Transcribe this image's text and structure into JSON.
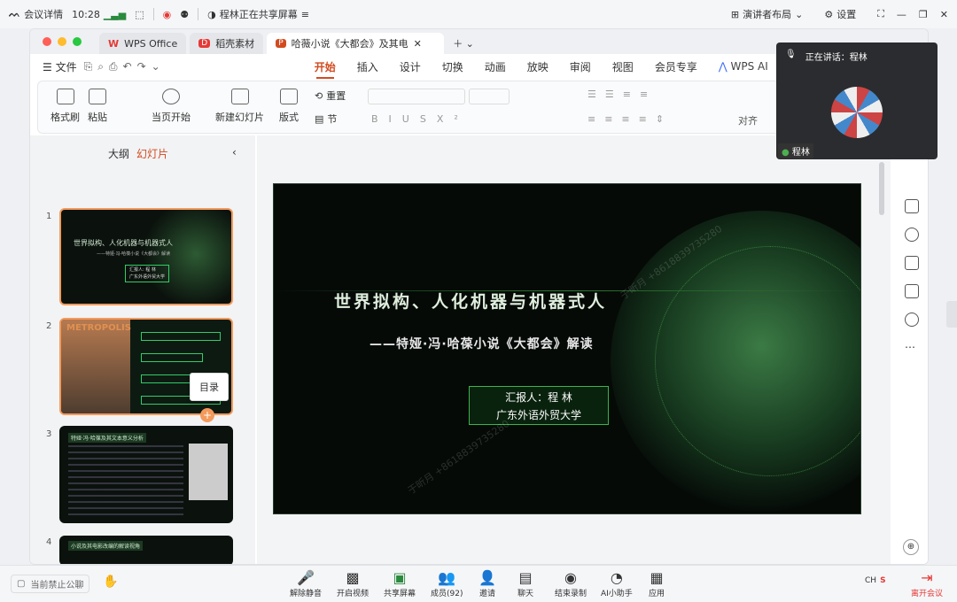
{
  "meeting": {
    "title": "会议详情",
    "time": "10:28",
    "sharing": "程林正在共享屏幕",
    "layout": "演讲者布局",
    "settings": "设置"
  },
  "tabs": [
    {
      "label": "WPS Office"
    },
    {
      "label": "稻壳素材"
    },
    {
      "label": "哈薇小说《大都会》及其电"
    }
  ],
  "menu": {
    "file": "文件",
    "items": [
      "开始",
      "插入",
      "设计",
      "切换",
      "动画",
      "放映",
      "审阅",
      "视图",
      "会员专享",
      "WPS AI"
    ]
  },
  "ribbon": {
    "format_painter": "格式刷",
    "paste": "粘贴",
    "current_start": "当页开始",
    "new_slide": "新建幻灯片",
    "layout": "版式",
    "section": "节",
    "reset": "重置",
    "align": "对齐"
  },
  "sidebar": {
    "outline": "大纲",
    "slides": "幻灯片",
    "context_menu": "目录",
    "thumbs": [
      {
        "num": "1",
        "title": "世界拟构、人化机器与机器式人",
        "sub": "——特娅·冯·哈葆小说《大都会》解读",
        "reporter": "汇报人: 程 林",
        "school": "广东外语外贸大学"
      },
      {
        "num": "2",
        "title": "METROPOLIS"
      },
      {
        "num": "3",
        "title": "特娅·冯·哈葆及其文本意义分析"
      },
      {
        "num": "4",
        "title": "小说及其电影改编的解读视角"
      }
    ]
  },
  "slide": {
    "title": "世界拟构、人化机器与机器式人",
    "subtitle": "——特娅·冯·哈葆小说《大都会》解读",
    "reporter": "汇报人：程 林",
    "school": "广东外语外贸大学",
    "watermark": "于昕月 +8618839735280"
  },
  "video": {
    "speaking": "正在讲话：程林",
    "name": "程林"
  },
  "bottom": {
    "public": "当前禁止公聊",
    "items": [
      "解除静音",
      "开启视频",
      "共享屏幕",
      "成员(92)",
      "邀请",
      "聊天",
      "结束录制",
      "AI小助手",
      "应用"
    ],
    "lang": "CH",
    "leave": "离开会议"
  }
}
